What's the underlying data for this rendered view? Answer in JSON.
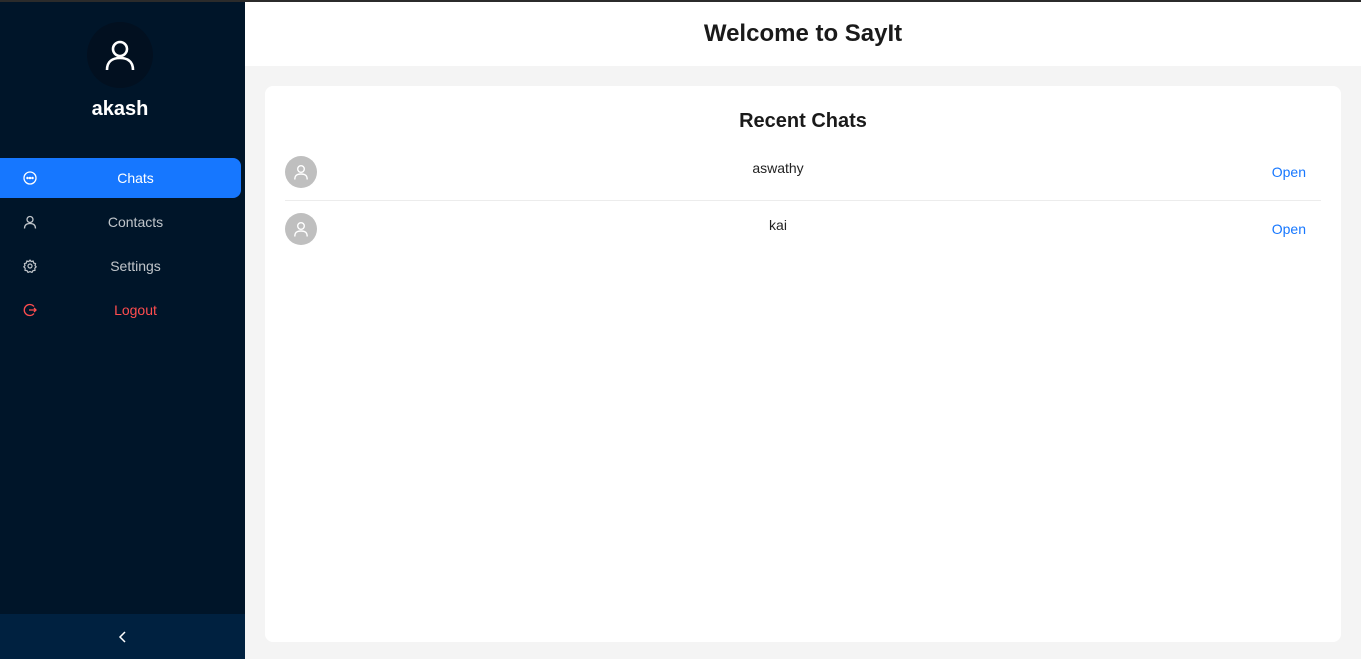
{
  "user": {
    "name": "akash"
  },
  "sidebar": {
    "items": [
      {
        "label": "Chats",
        "icon": "chat-icon",
        "active": true
      },
      {
        "label": "Contacts",
        "icon": "user-icon"
      },
      {
        "label": "Settings",
        "icon": "gear-icon"
      },
      {
        "label": "Logout",
        "icon": "logout-icon"
      }
    ],
    "collapse_icon": "chevron-left-icon"
  },
  "header": {
    "title": "Welcome to SayIt"
  },
  "main": {
    "card_title": "Recent Chats",
    "chats": [
      {
        "name": "aswathy",
        "action": "Open"
      },
      {
        "name": "kai",
        "action": "Open"
      }
    ]
  },
  "colors": {
    "sidebar_bg": "#001529",
    "accent": "#1677ff",
    "logout": "#ff4d4f"
  }
}
